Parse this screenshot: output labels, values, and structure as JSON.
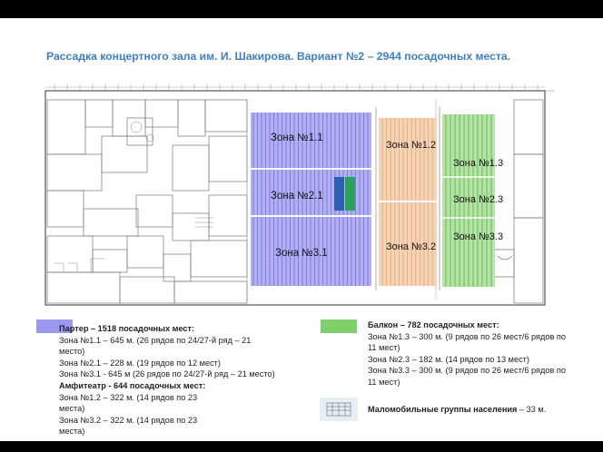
{
  "title": "Рассадка концертного зала им. И. Шакирова. Вариант №2 –  2944 посадочных места.",
  "colors": {
    "parter": "#9b99ee",
    "amphi": "#f3c6a0",
    "balcony": "#7fcf6c",
    "title": "#3f7fc0"
  },
  "zones": {
    "z11": "Зона №1.1",
    "z21": "Зона №2.1",
    "z31": "Зона №3.1",
    "z12": "Зона №1.2",
    "z32": "Зона №3.2",
    "z13": "Зона №1.3",
    "z23": "Зона №2.3",
    "z33": "Зона №3.3"
  },
  "legend": {
    "parter": {
      "header": "Партер – 1518 посадочных мест:",
      "lines": [
        "Зона №1.1 – 645 м. (26 рядов по 24/27-й ряд – 21",
        "место)",
        "Зона №2.1 – 228 м. (19 рядов по 12 мест)",
        "Зона №3.1 - 645 м (26 рядов по 24/27-й ряд – 21 место)"
      ]
    },
    "amphi": {
      "header": "Амфитеатр - 644 посадочных мест:",
      "lines": [
        "Зона №1.2 – 322 м. (14 рядов по 23",
        "места)",
        "Зона №3.2 – 322 м. (14 рядов по 23",
        "места)"
      ]
    },
    "balcony": {
      "header": "Балкон – 782 посадочных мест:",
      "lines": [
        "Зона №1.3 – 300 м. (9 рядов по 26 мест/6 рядов по",
        "11 мест)",
        "Зона №2.3 – 182 м. (14 рядов по 13 мест)",
        "Зона №3.3 – 300 м. (9 рядов по 26 мест/6 рядов по",
        "11 мест)"
      ]
    },
    "mobility": {
      "label": "Маломобильные группы населения",
      "value": "– 33 м."
    }
  }
}
